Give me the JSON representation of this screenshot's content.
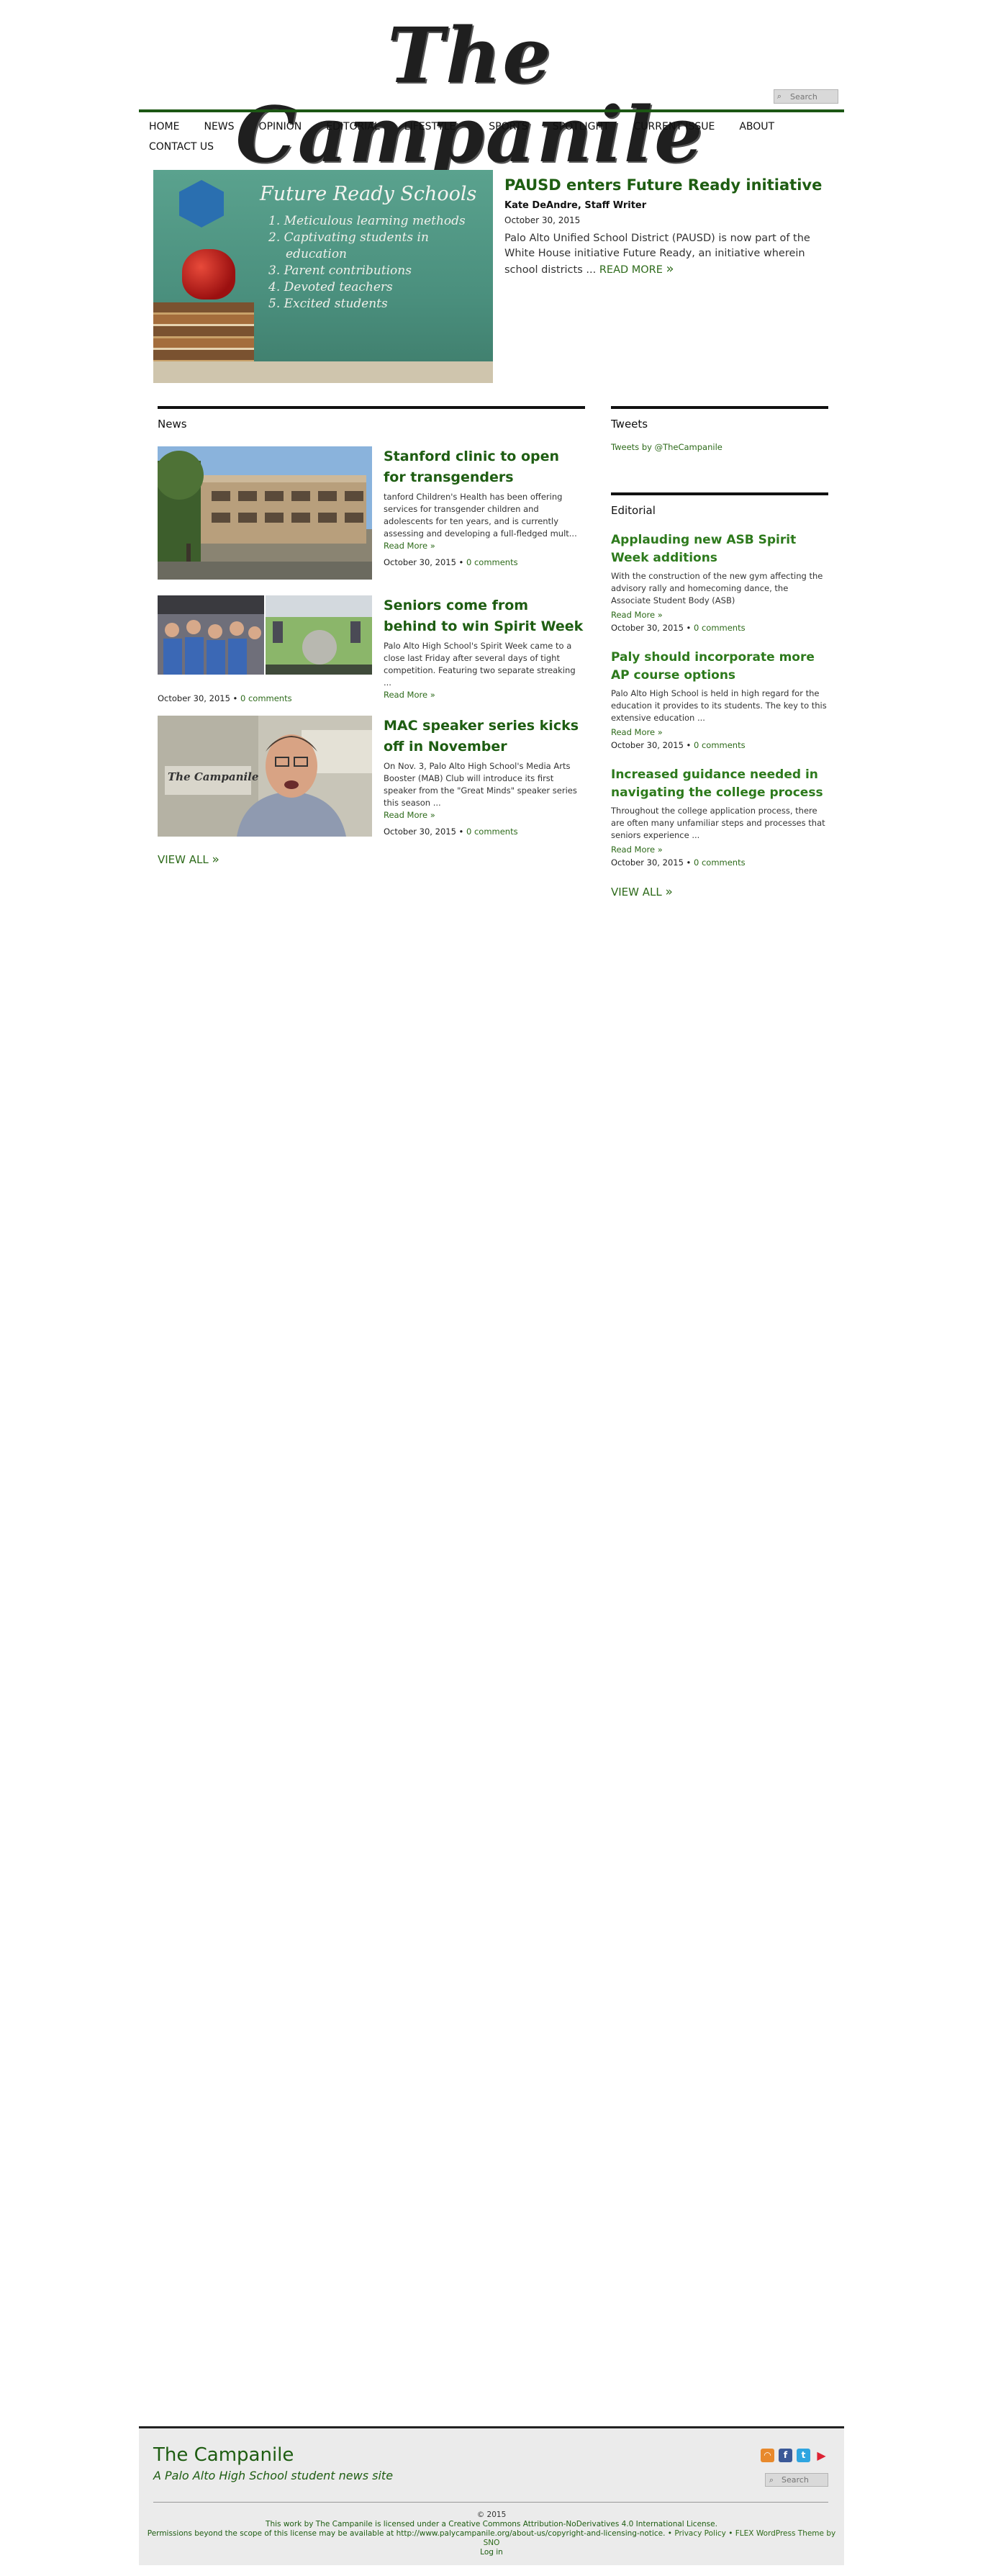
{
  "masthead": {
    "title": "The Campanile",
    "search_placeholder": "Search"
  },
  "nav": {
    "items": [
      "HOME",
      "NEWS",
      "OPINION",
      "EDITORIAL",
      "LIFESTYLE",
      "SPORTS",
      "SPOTLIGHT",
      "CURRENT ISSUE",
      "ABOUT",
      "CONTACT US"
    ]
  },
  "feature": {
    "image_title": "Future Ready Schools",
    "image_list": [
      "1. Meticulous learning methods",
      "2. Captivating students in",
      "education",
      "3. Parent contributions",
      "4. Devoted teachers",
      "5. Excited students"
    ],
    "title": "PAUSD enters Future Ready initiative",
    "author": "Kate DeAndre, Staff Writer",
    "date": "October 30, 2015",
    "excerpt": "Palo Alto Unified School District (PAUSD) is now part of the White House initiative Future Ready, an initiative wherein school districts ...",
    "read_more": "READ MORE",
    "read_more_chev": "»"
  },
  "news": {
    "heading": "News",
    "stories": [
      {
        "title": "Stanford clinic to open for transgenders",
        "excerpt": "tanford Children's Health has been offering services for transgender children and adolescents for ten years, and is currently assessing and developing a full-fledged mult...",
        "read_more": "Read More »",
        "date": "October 30, 2015",
        "sep": "•",
        "comments": "0 comments"
      },
      {
        "title": "Seniors come from behind to win Spirit Week",
        "excerpt": "Palo Alto High School's Spirit Week came to a close last Friday after several days of tight competition. Featuring two separate streaking ...",
        "read_more": "Read More »",
        "date": "October 30, 2015",
        "sep": "•",
        "comments": "0 comments"
      },
      {
        "title": "MAC speaker series kicks off in November",
        "excerpt": "On Nov. 3, Palo Alto High School's Media Arts Booster (MAB) Club will introduce its first speaker from the \"Great Minds\" speaker series this season ...",
        "read_more": "Read More »",
        "date": "October 30, 2015",
        "sep": "•",
        "comments": "0 comments"
      }
    ],
    "image3_sign": "The Campanile",
    "view_all": "VIEW ALL",
    "view_all_chev": "»"
  },
  "tweets": {
    "heading": "Tweets",
    "link": "Tweets by @TheCampanile"
  },
  "editorial": {
    "heading": "Editorial",
    "items": [
      {
        "title": "Applauding new ASB Spirit Week additions",
        "excerpt": "With the construction of the new gym affecting the advisory rally and homecoming dance, the Associate Student Body (ASB)",
        "read_more": "Read More »",
        "date": "October 30, 2015",
        "sep": "•",
        "comments": "0 comments"
      },
      {
        "title": "Paly should incorporate more AP course options",
        "excerpt": "Palo Alto High School is held in high regard for the education it provides to its students. The key to this extensive education ...",
        "read_more": "Read More »",
        "date": "October 30, 2015",
        "sep": "•",
        "comments": "0 comments"
      },
      {
        "title": "Increased guidance needed in navigating the college process",
        "excerpt": "Throughout the college application process, there are often many unfamiliar steps and processes that seniors experience ...",
        "read_more": "Read More »",
        "date": "October 30, 2015",
        "sep": "•",
        "comments": "0 comments"
      }
    ],
    "view_all": "VIEW ALL",
    "view_all_chev": "»"
  },
  "footer": {
    "title": "The Campanile",
    "tagline": "A Palo Alto High School student news site",
    "search_placeholder": "Search",
    "copyright": "© 2015",
    "license": "This work by The Campanile is licensed under a Creative Commons Attribution-NoDerivatives 4.0 International License.",
    "permissions": "Permissions beyond the scope of this license may be available at http://www.palycampanile.org/about-us/copyright-and-licensing-notice.",
    "privacy": "Privacy Policy",
    "theme": "FLEX WordPress Theme by SNO",
    "login": "Log in",
    "sep": "•",
    "icons": [
      "rss-icon",
      "facebook-icon",
      "twitter-icon",
      "youtube-icon"
    ]
  },
  "colors": {
    "accent_green": "#1e5d12",
    "link_green": "#2d6a1a",
    "nav_rule": "#1c5714",
    "footer_bg": "#ebebeb"
  }
}
